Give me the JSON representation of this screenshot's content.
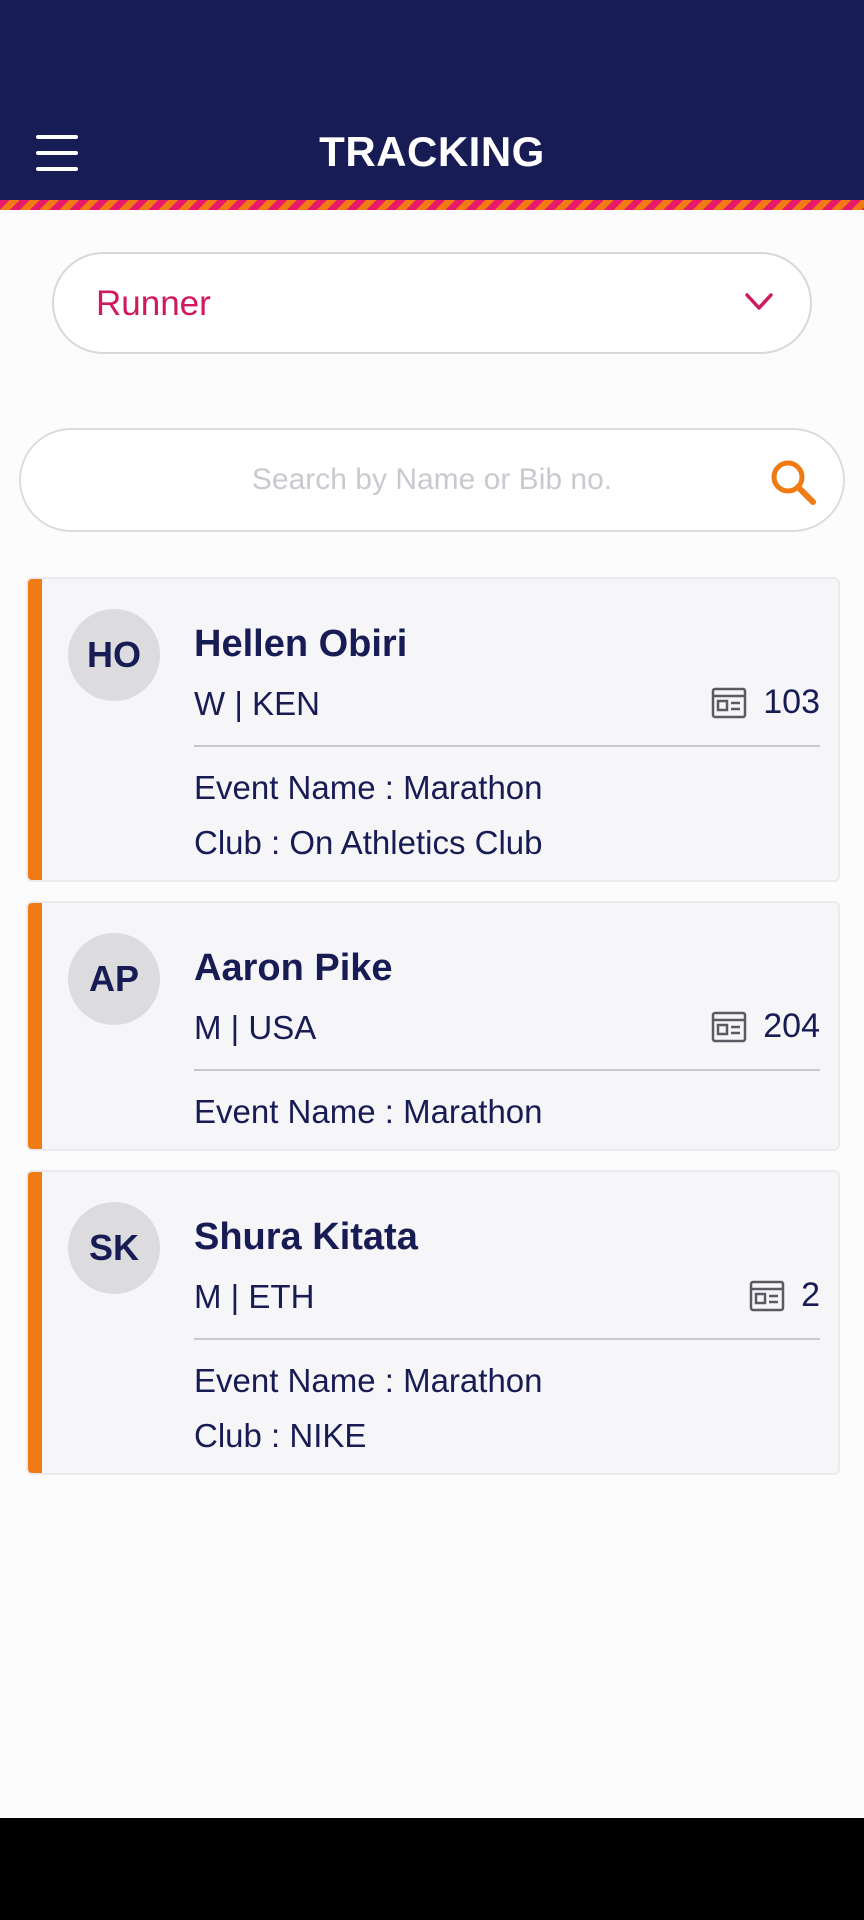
{
  "header": {
    "title": "TRACKING",
    "menu_icon": "hamburger-menu-icon",
    "background": "#171c54"
  },
  "filter": {
    "selected": "Runner",
    "icon": "chevron-down-icon",
    "accent": "#d0195f"
  },
  "search": {
    "placeholder": "Search by Name or Bib no.",
    "value": "",
    "icon": "search-icon",
    "icon_color": "#f07a13"
  },
  "runners": [
    {
      "initials": "HO",
      "name": "Hellen Obiri",
      "meta": "W | KEN",
      "bib": "103",
      "event": "Event Name : Marathon",
      "club": "Club : On Athletics Club"
    },
    {
      "initials": "AP",
      "name": "Aaron Pike",
      "meta": "M | USA",
      "bib": "204",
      "event": "Event Name : Marathon"
    },
    {
      "initials": "SK",
      "name": "Shura Kitata",
      "meta": "M | ETH",
      "bib": "2",
      "event": "Event Name : Marathon",
      "club": "Club : NIKE"
    }
  ],
  "colors": {
    "accent_orange": "#f07a13",
    "accent_pink": "#e8196b",
    "text_navy": "#171c54"
  }
}
